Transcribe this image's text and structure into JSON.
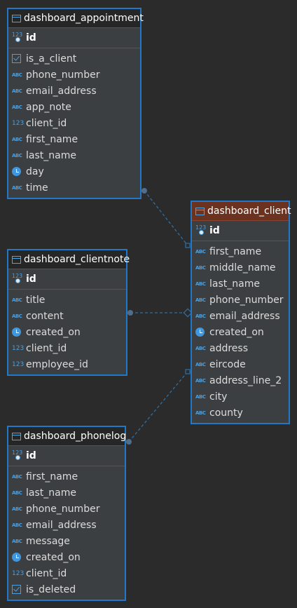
{
  "tables": {
    "appointment": {
      "name": "dashboard_appointment",
      "pk": "id",
      "columns": [
        {
          "name": "is_a_client",
          "type_icon": "checkbox-icon"
        },
        {
          "name": "phone_number",
          "type_icon": "abc-icon"
        },
        {
          "name": "email_address",
          "type_icon": "abc-icon"
        },
        {
          "name": "app_note",
          "type_icon": "abc-icon"
        },
        {
          "name": "client_id",
          "type_icon": "number-icon"
        },
        {
          "name": "first_name",
          "type_icon": "abc-icon"
        },
        {
          "name": "last_name",
          "type_icon": "abc-icon"
        },
        {
          "name": "day",
          "type_icon": "clock-icon"
        },
        {
          "name": "time",
          "type_icon": "abc-icon"
        }
      ]
    },
    "client": {
      "name": "dashboard_client",
      "pk": "id",
      "highlighted": true,
      "columns": [
        {
          "name": "first_name",
          "type_icon": "abc-icon"
        },
        {
          "name": "middle_name",
          "type_icon": "abc-icon"
        },
        {
          "name": "last_name",
          "type_icon": "abc-icon"
        },
        {
          "name": "phone_number",
          "type_icon": "abc-icon"
        },
        {
          "name": "email_address",
          "type_icon": "abc-icon"
        },
        {
          "name": "created_on",
          "type_icon": "clock-icon"
        },
        {
          "name": "address",
          "type_icon": "abc-icon"
        },
        {
          "name": "eircode",
          "type_icon": "abc-icon"
        },
        {
          "name": "address_line_2",
          "type_icon": "abc-icon"
        },
        {
          "name": "city",
          "type_icon": "abc-icon"
        },
        {
          "name": "county",
          "type_icon": "abc-icon"
        }
      ]
    },
    "clientnote": {
      "name": "dashboard_clientnote",
      "pk": "id",
      "columns": [
        {
          "name": "title",
          "type_icon": "abc-icon"
        },
        {
          "name": "content",
          "type_icon": "abc-icon"
        },
        {
          "name": "created_on",
          "type_icon": "clock-icon"
        },
        {
          "name": "client_id",
          "type_icon": "number-icon"
        },
        {
          "name": "employee_id",
          "type_icon": "number-icon"
        }
      ]
    },
    "phonelog": {
      "name": "dashboard_phonelog",
      "pk": "id",
      "columns": [
        {
          "name": "first_name",
          "type_icon": "abc-icon"
        },
        {
          "name": "last_name",
          "type_icon": "abc-icon"
        },
        {
          "name": "phone_number",
          "type_icon": "abc-icon"
        },
        {
          "name": "email_address",
          "type_icon": "abc-icon"
        },
        {
          "name": "message",
          "type_icon": "abc-icon"
        },
        {
          "name": "created_on",
          "type_icon": "clock-icon"
        },
        {
          "name": "client_id",
          "type_icon": "number-icon"
        },
        {
          "name": "is_deleted",
          "type_icon": "checkbox-icon"
        }
      ]
    }
  },
  "relationships": [
    {
      "from": "dashboard_appointment",
      "to": "dashboard_client"
    },
    {
      "from": "dashboard_clientnote",
      "to": "dashboard_client"
    },
    {
      "from": "dashboard_phonelog",
      "to": "dashboard_client"
    }
  ],
  "type_glyphs": {
    "abc-icon": "ABC",
    "number-icon": "123"
  },
  "colors": {
    "background": "#2b2b2b",
    "table_border": "#1f78c8",
    "highlight_header": "#6b3220",
    "relationship_line": "#2f6fa3",
    "icon_blue": "#4a9fe0"
  }
}
